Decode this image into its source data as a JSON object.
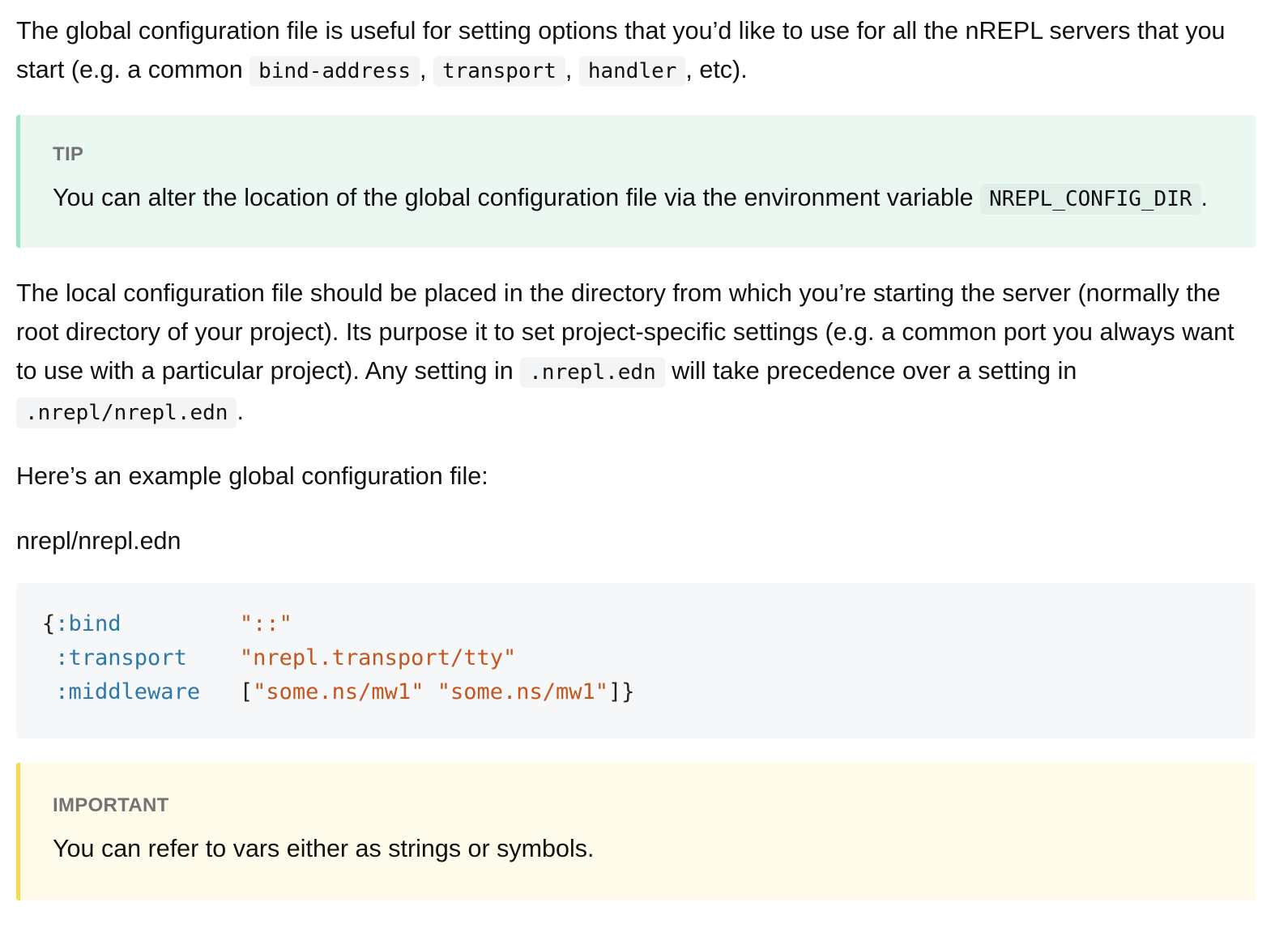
{
  "intro": {
    "text_1": "The global configuration file is useful for setting options that you’d like to use for all the nREPL servers that you start (e.g. a common",
    "code_1": "bind-address",
    "sep_1": ",",
    "code_2": "transport",
    "sep_2": ",",
    "code_3": "handler",
    "text_2": ", etc)."
  },
  "tip": {
    "title": "TIP",
    "text_1": "You can alter the location of the global configuration file via the environment variable",
    "code": "NREPL_CONFIG_DIR",
    "text_2": "."
  },
  "local": {
    "text_1": "The local configuration file should be placed in the directory from which you’re starting the server (normally the root directory of your project). Its purpose it to set project-specific settings (e.g. a common port you always want to use with a particular project). Any setting in",
    "code_1": ".nrepl.edn",
    "text_2": "will take precedence over a setting in",
    "code_2": ".nrepl/nrepl.edn",
    "text_3": "."
  },
  "example_intro": "Here’s an example global configuration file:",
  "file_name": "nrepl/nrepl.edn",
  "code_block": {
    "line_1": {
      "open_brace": "{",
      "key": ":bind",
      "pad": "         ",
      "value": "\"::\""
    },
    "line_2": {
      "indent": " ",
      "key": ":transport",
      "pad": "    ",
      "value": "\"nrepl.transport/tty\""
    },
    "line_3": {
      "indent": " ",
      "key": ":middleware",
      "pad": "   ",
      "open_bracket": "[",
      "value_1": "\"some.ns/mw1\"",
      "space": " ",
      "value_2": "\"some.ns/mw1\"",
      "close": "]}"
    }
  },
  "important": {
    "title": "IMPORTANT",
    "text": "You can refer to vars either as strings or symbols."
  },
  "colors": {
    "tip_background": "#ebf8f2",
    "tip_border": "#9ce3c4",
    "important_background": "#fffbeb",
    "important_border": "#f7d94c",
    "code_keyword": "#2e78a6",
    "code_string": "#c4551d"
  }
}
